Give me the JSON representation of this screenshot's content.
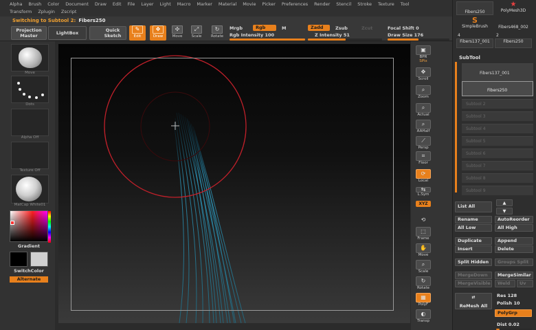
{
  "menu": {
    "row1": [
      "Alpha",
      "Brush",
      "Color",
      "Document",
      "Draw",
      "Edit",
      "File",
      "Layer",
      "Light",
      "Macro",
      "Marker",
      "Material",
      "Movie",
      "Picker",
      "Preferences",
      "Render",
      "Stencil",
      "Stroke",
      "Texture",
      "Tool"
    ],
    "row2": [
      "Transform",
      "Zplugin",
      "Zscript"
    ]
  },
  "status": {
    "label": "Switching to Subtool 2:",
    "value": "Fibers250"
  },
  "topbar": {
    "projection_master": "Projection Master",
    "lightbox": "LightBox",
    "quick_sketch": "Quick Sketch",
    "tools": [
      {
        "label": "Edit",
        "icon": "edit-icon",
        "active": true
      },
      {
        "label": "Draw",
        "icon": "draw-icon",
        "active": true
      },
      {
        "label": "Move",
        "icon": "move-icon",
        "active": false
      },
      {
        "label": "Scale",
        "icon": "scale-icon",
        "active": false
      },
      {
        "label": "Rotate",
        "icon": "rotate-icon",
        "active": false
      }
    ],
    "mrgb": "Mrgb",
    "rgb": "Rgb",
    "m": "M",
    "rgb_intensity_label": "Rgb Intensity",
    "rgb_intensity_value": "100",
    "zadd": "Zadd",
    "zsub": "Zsub",
    "zcut": "Zcut",
    "z_intensity_label": "Z Intensity",
    "z_intensity_value": "51",
    "focal_shift_label": "Focal Shift",
    "focal_shift_value": "0",
    "draw_size_label": "Draw Size",
    "draw_size_value": "176"
  },
  "left_shelf": {
    "brush_label": "Move",
    "stroke_label": "Dots",
    "alpha_label": "Alpha Off",
    "texture_label": "Texture Off",
    "material_label": "MatCap White01",
    "gradient_label": "Gradient",
    "switch_color_label": "SwitchColor",
    "alternate_label": "Alternate"
  },
  "right_shelf": [
    {
      "label": "BPR",
      "icon": "bpr-icon"
    },
    {
      "label": "SPix",
      "icon": "spix-icon"
    },
    {
      "label": "Scroll",
      "icon": "scroll-icon"
    },
    {
      "label": "Zoom",
      "icon": "zoom-icon"
    },
    {
      "label": "Actual",
      "icon": "actual-icon"
    },
    {
      "label": "AAHalf",
      "icon": "aahalf-icon"
    },
    {
      "label": "Persp",
      "icon": "persp-icon"
    },
    {
      "label": "Floor",
      "icon": "floor-icon"
    },
    {
      "label": "Local",
      "icon": "local-icon"
    },
    {
      "label": "L.Sym",
      "icon": "lsym-icon"
    },
    {
      "label": "XYZ",
      "icon": "xyz-icon"
    },
    {
      "label": "Frame",
      "icon": "frame-icon"
    },
    {
      "label": "Move",
      "icon": "move-icon"
    },
    {
      "label": "Scale",
      "icon": "scale-icon"
    },
    {
      "label": "Rotate",
      "icon": "rotate-icon"
    },
    {
      "label": "PolyF",
      "icon": "polyf-icon"
    },
    {
      "label": "Transp",
      "icon": "transp-icon"
    }
  ],
  "tray": {
    "brushes": [
      "Fibers250",
      "PolyMesh3D",
      "SimpleBrush",
      "Fibers468_002",
      "Fibers137_001",
      "Fibers250"
    ],
    "brush_counts": [
      "4",
      "2"
    ],
    "subtool_title": "SubTool",
    "subtool_items": [
      "Fibers137_001",
      "Fibers250"
    ],
    "empty_slots": [
      "Subtool 2",
      "Subtool 3",
      "Subtool 4",
      "Subtool 5",
      "Subtool 6",
      "Subtool 7",
      "Subtool 8",
      "Subtool 9"
    ],
    "list_all": "List All",
    "rename": "Rename",
    "auto_reorder": "AutoReorder",
    "all_low": "All Low",
    "all_high": "All High",
    "duplicate": "Duplicate",
    "append": "Append",
    "insert": "Insert",
    "delete": "Delete",
    "split_hidden": "Split Hidden",
    "groups_split": "Groups Split",
    "merge_down": "MergeDown",
    "merge_similar": "MergeSimilar",
    "merge_visible": "MergeVisible",
    "weld": "Weld",
    "uv": "Uv",
    "remesh_all": "ReMesh All",
    "res_label": "Res",
    "res_value": "128",
    "polish_label": "Polish",
    "polish_value": "10",
    "polygrp": "PolyGrp",
    "dist_label": "Dist",
    "dist_value": "0.02"
  },
  "colors": {
    "accent": "#e8801c",
    "brush_circle": "#c0202a",
    "fibers": "#3aa0c0"
  }
}
